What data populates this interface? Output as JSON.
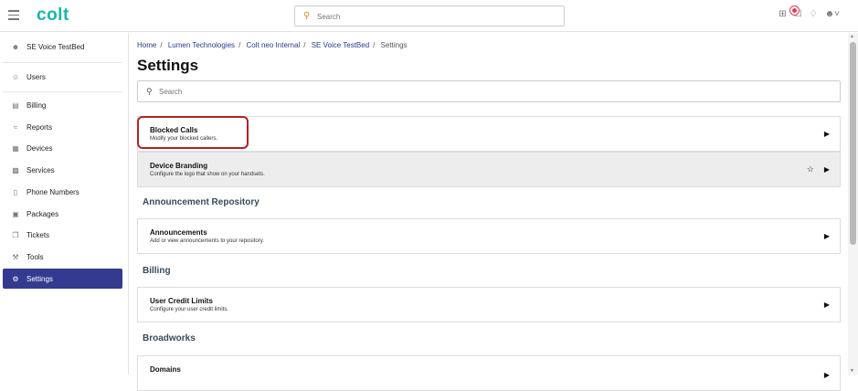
{
  "app": {
    "logo": "colt"
  },
  "topbar": {
    "search_placeholder": "Search",
    "icons": [
      "grid-icon",
      "tasks-icon",
      "bell-icon",
      "user-icon"
    ],
    "notification_color": "#e23b5a"
  },
  "sidebar": {
    "account": "SE Voice TestBed",
    "items": [
      {
        "label": "Users",
        "icon": "users-icon"
      },
      {
        "label": "Billing",
        "icon": "billing-icon"
      },
      {
        "label": "Reports",
        "icon": "reports-icon"
      },
      {
        "label": "Devices",
        "icon": "devices-icon"
      },
      {
        "label": "Services",
        "icon": "services-icon"
      },
      {
        "label": "Phone Numbers",
        "icon": "phone-icon"
      },
      {
        "label": "Packages",
        "icon": "packages-icon"
      },
      {
        "label": "Tickets",
        "icon": "tickets-icon"
      },
      {
        "label": "Tools",
        "icon": "tools-icon"
      },
      {
        "label": "Settings",
        "icon": "settings-icon",
        "active": true
      }
    ],
    "active_color": "#333a8f"
  },
  "breadcrumb": [
    "Home",
    "Lumen Technologies",
    "Colt neo Internal",
    "SE Voice TestBed",
    "Settings"
  ],
  "page": {
    "title": "Settings",
    "search_placeholder": "Search"
  },
  "cards": [
    {
      "title": "Blocked Calls",
      "desc": "Modify your blocked callers."
    },
    {
      "title": "Device Branding",
      "desc": "Configure the logo that show on your handsets."
    },
    {
      "title": "Announcements",
      "desc": "Add or view announcements to your repository."
    },
    {
      "title": "User Credit Limits",
      "desc": "Configure your user credit limits."
    },
    {
      "title": "Domains",
      "desc": ""
    }
  ],
  "sections": [
    "Announcement Repository",
    "Billing",
    "Broadworks"
  ],
  "glyphs": {
    "arrow": "▶",
    "star": "☆"
  }
}
